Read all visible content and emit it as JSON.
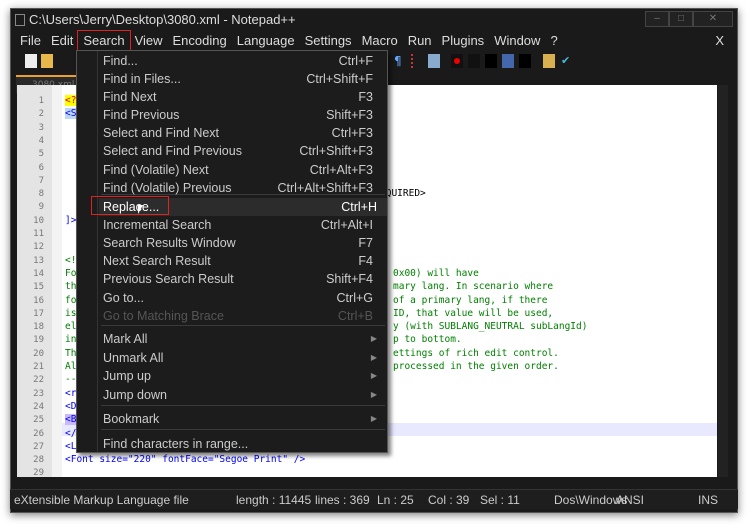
{
  "window": {
    "title": "C:\\Users\\Jerry\\Desktop\\3080.xml - Notepad++"
  },
  "menubar": [
    "File",
    "Edit",
    "Search",
    "View",
    "Encoding",
    "Language",
    "Settings",
    "Macro",
    "Run",
    "Plugins",
    "Window",
    "?"
  ],
  "menubar_close": "X",
  "tab": {
    "label": "3080.xml"
  },
  "search_menu": {
    "items": [
      {
        "label": "Find...",
        "shortcut": "Ctrl+F"
      },
      {
        "label": "Find in Files...",
        "shortcut": "Ctrl+Shift+F"
      },
      {
        "label": "Find Next",
        "shortcut": "F3"
      },
      {
        "label": "Find Previous",
        "shortcut": "Shift+F3"
      },
      {
        "label": "Select and Find Next",
        "shortcut": "Ctrl+F3"
      },
      {
        "label": "Select and Find Previous",
        "shortcut": "Ctrl+Shift+F3"
      },
      {
        "label": "Find (Volatile) Next",
        "shortcut": "Ctrl+Alt+F3"
      },
      {
        "label": "Find (Volatile) Previous",
        "shortcut": "Ctrl+Alt+Shift+F3"
      },
      {
        "label": "Replace...",
        "shortcut": "Ctrl+H"
      },
      {
        "label": "Incremental Search",
        "shortcut": "Ctrl+Alt+I"
      },
      {
        "label": "Search Results Window",
        "shortcut": "F7"
      },
      {
        "label": "Next Search Result",
        "shortcut": "F4"
      },
      {
        "label": "Previous Search Result",
        "shortcut": "Shift+F4"
      },
      {
        "label": "Go to...",
        "shortcut": "Ctrl+G"
      },
      {
        "label": "Go to Matching Brace",
        "shortcut": "Ctrl+B"
      },
      {
        "label": "Mark All",
        "shortcut": ""
      },
      {
        "label": "Unmark All",
        "shortcut": ""
      },
      {
        "label": "Jump up",
        "shortcut": ""
      },
      {
        "label": "Jump down",
        "shortcut": ""
      },
      {
        "label": "Bookmark",
        "shortcut": ""
      },
      {
        "label": "Find characters in range...",
        "shortcut": ""
      }
    ]
  },
  "editor": {
    "line_numbers": [
      "1",
      "2",
      "3",
      "4",
      "5",
      "6",
      "7",
      "8",
      "9",
      "10",
      "11",
      "12",
      "13",
      "14",
      "15",
      "16",
      "17",
      "18",
      "19",
      "20",
      "21",
      "22",
      "23",
      "24",
      "25",
      "26",
      "27",
      "28",
      "29"
    ],
    "left_fragments": {
      "1": "<?",
      "2": "<S",
      "10": "]>",
      "13": "<!",
      "14": "Fo",
      "15": "th",
      "16": "fo",
      "17": "is",
      "18": "el",
      "19": "in",
      "20": "Th",
      "21": "Al",
      "22": "--",
      "23": "<r",
      "24": "<D",
      "25": "<B",
      "26": "</"
    },
    "right_fragments": {
      "8": "EQUIRED>",
      "9": ">",
      "14": "0x00) will have",
      "15": "mary lang. In scenario where",
      "16": "of a primary lang, if there",
      "17": "ID, that value will be used,",
      "18": "y (with SUBLANG_NEUTRAL subLangId)",
      "19": "p to bottom.",
      "20": "ettings of rich edit control.",
      "21": "processed in the given order."
    },
    "line27": "<Language primaryLangId=\"0x05\">",
    "line28": "<Font size=\"220\" fontFace=\"Segoe Print\" />"
  },
  "status": {
    "type": "eXtensible Markup Language file",
    "length": "length : 11445",
    "lines": "lines : 369",
    "ln": "Ln : 25",
    "col": "Col : 39",
    "sel": "Sel : 11",
    "eol": "Dos\\Windows",
    "enc": "ANSI",
    "mode": "INS"
  }
}
